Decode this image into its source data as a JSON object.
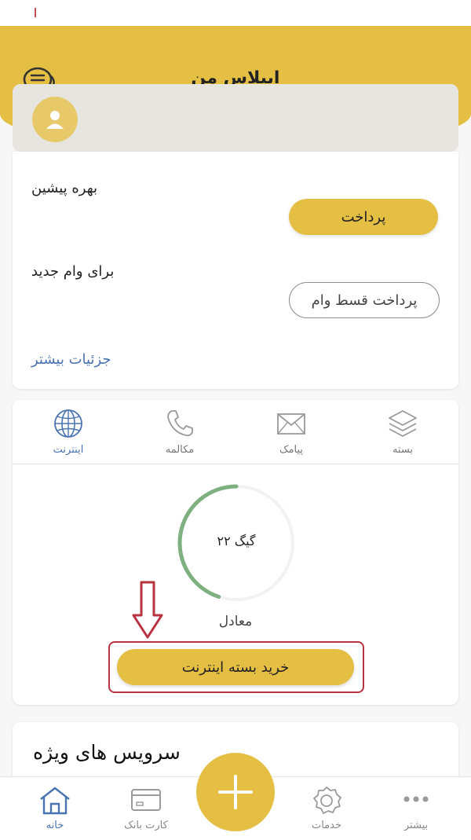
{
  "header": {
    "title": "ﺍﯾﭙﻼﺱ ﻣﻦ",
    "chat_icon": "chat-bubbles-icon",
    "color": "#e4bf44"
  },
  "profile": {
    "avatar_icon": "user-avatar-icon"
  },
  "account_card": {
    "balance_label": "ﺑﻬﺮﻩ ﭘﯿﺸﯿﻦ",
    "pay_button": "ﭘﺮﺩﺍﺧﺖ",
    "installment_label": "ﺑﺮﺍﯼ ﻭﺍﻡ ﺟﺪﯾﺪ",
    "pay_installment_button": "ﭘﺮﺩﺍﺧﺖ ﻗﺴﻂ ﻭﺍﻡ",
    "details_link": "ﺟﺰﺋﯿﺎﺕ ﺑﯿﺸﺘﺮ"
  },
  "services": {
    "tabs": [
      {
        "label": "ﺍﯾﻨﺘﺮﻧﺖ",
        "icon": "globe-icon",
        "active": true
      },
      {
        "label": "ﻣﮑﺎﻟﻤﻪ",
        "icon": "phone-icon",
        "active": false
      },
      {
        "label": "ﭘﯿﺎﻣﮏ",
        "icon": "envelope-icon",
        "active": false
      },
      {
        "label": "ﺑﺴﺘﻪ",
        "icon": "layers-icon",
        "active": false
      }
    ],
    "progress": {
      "value_text": "۲۲ ﮔﯿﮓ",
      "fraction": 0.45,
      "color": "#7fb07f",
      "caption": "ﻣﻌﺎﺩﻝ"
    },
    "buy_button": "ﺧﺮﯾﺪ ﺑﺴﺘﻪ ﺍﯾﻨﺘﺮﻧﺖ"
  },
  "offers": {
    "title": "ﺳﺮﻭﯾﺲ ﻫﺎﯼ ﻭﯾﮋﻩ"
  },
  "bottom_nav": {
    "items": [
      {
        "label": "ﺧﺎﻧﻪ",
        "icon": "home-icon",
        "active": true
      },
      {
        "label": "ﮐﺎﺭﺕ ﺑﺎﻧﮏ",
        "icon": "bank-card-icon",
        "active": false
      },
      {
        "label": "ﺧﺪﻣﺎﺕ",
        "icon": "services-badge-icon",
        "active": false
      },
      {
        "label": "ﺑﯿﺸﺘﺮ",
        "icon": "more-dots-icon",
        "active": false
      }
    ],
    "fab_icon": "plus-icon"
  }
}
